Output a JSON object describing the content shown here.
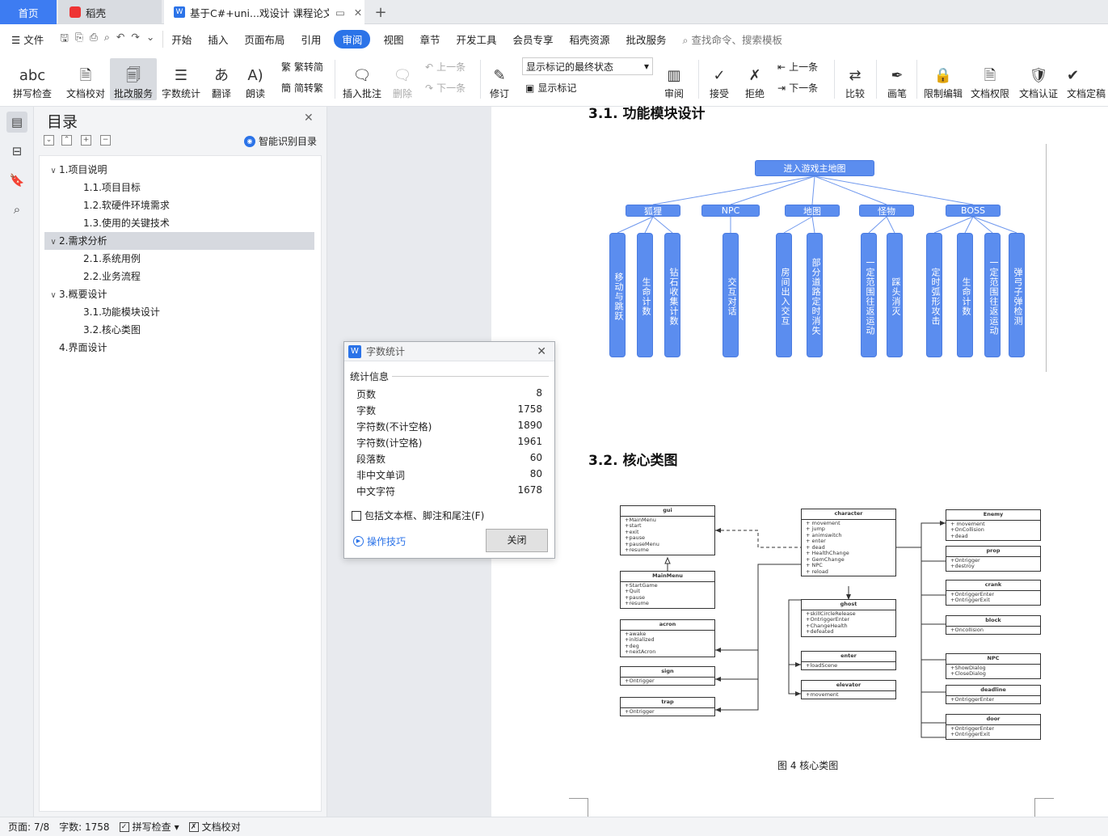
{
  "tabs": {
    "home": "首页",
    "daoke": "稻壳",
    "doc": "基于C#+uni...戏设计 课程论文",
    "add": "+"
  },
  "menu": {
    "file": "文件",
    "items": [
      "开始",
      "插入",
      "页面布局",
      "引用",
      "审阅",
      "视图",
      "章节",
      "开发工具",
      "会员专享",
      "稻壳资源",
      "批改服务"
    ],
    "active_index": 4,
    "search": "查找命令、搜索模板"
  },
  "ribbon": {
    "spell": "拼写检查",
    "proof": "文档校对",
    "review_service": "批改服务",
    "word_count": "字数统计",
    "translate": "翻译",
    "read_aloud": "朗读",
    "to_trad": "繁转简",
    "to_simp": "简转繁",
    "insert_comment": "插入批注",
    "delete": "删除",
    "prev": "上一条",
    "next": "下一条",
    "revise": "修订",
    "markup_select": "显示标记的最终状态",
    "show_markup": "显示标记",
    "review_pane": "审阅",
    "accept": "接受",
    "reject": "拒绝",
    "prev2": "上一条",
    "next2": "下一条",
    "compare": "比较",
    "pen": "画笔",
    "restrict": "限制编辑",
    "doc_rights": "文档权限",
    "doc_cert": "文档认证",
    "doc_final": "文档定稿"
  },
  "toc": {
    "title": "目录",
    "smart": "智能识别目录",
    "items": [
      {
        "label": "1.项目说明",
        "level": 1,
        "caret": "∨"
      },
      {
        "label": "1.1.项目目标",
        "level": 2
      },
      {
        "label": "1.2.软硬件环境需求",
        "level": 2
      },
      {
        "label": "1.3.使用的关键技术",
        "level": 2
      },
      {
        "label": "2.需求分析",
        "level": 1,
        "caret": "∨",
        "selected": true
      },
      {
        "label": "2.1.系统用例",
        "level": 2
      },
      {
        "label": "2.2.业务流程",
        "level": 2
      },
      {
        "label": "3.概要设计",
        "level": 1,
        "caret": "∨"
      },
      {
        "label": "3.1.功能模块设计",
        "level": 2
      },
      {
        "label": "3.2.核心类图",
        "level": 2
      },
      {
        "label": "4.界面设计",
        "level": 1
      }
    ]
  },
  "doc": {
    "h_31": "3.1. 功能模块设计",
    "h_32": "3.2. 核心类图",
    "mindmap": {
      "root": "进入游戏主地图",
      "branches": [
        {
          "name": "狐狸",
          "leaves": [
            "移动与跳跃",
            "生命计数",
            "钻石收集计数"
          ]
        },
        {
          "name": "NPC",
          "leaves": [
            "交互对话"
          ]
        },
        {
          "name": "地图",
          "leaves": [
            "房间出入交互",
            "部分道路定时消失"
          ]
        },
        {
          "name": "怪物",
          "leaves": [
            "一定范围往返运动",
            "踩头消灭"
          ]
        },
        {
          "name": "BOSS",
          "leaves": [
            "定时弧形攻击",
            "生命计数",
            "一定范围往返运动",
            "弹弓子弹检测"
          ]
        }
      ]
    },
    "uml": {
      "gui": {
        "title": "gui",
        "members": [
          "+MainMenu",
          "+start",
          "+exit",
          "+pause",
          "+pauseMenu",
          "+resume"
        ]
      },
      "mainmenu": {
        "title": "MainMenu",
        "members": [
          "+StartGame",
          "+Quit",
          "+pause",
          "+resume"
        ]
      },
      "acron": {
        "title": "acron",
        "members": [
          "+awake",
          "+initialized",
          "+deg",
          "+nextAcron"
        ]
      },
      "sign": {
        "title": "sign",
        "members": [
          "+Ontrigger"
        ]
      },
      "trap": {
        "title": "trap",
        "members": [
          "+Ontrigger"
        ]
      },
      "character": {
        "title": "character",
        "members": [
          "+ movement",
          "+ jump",
          "+ animswitch",
          "+ enter",
          "+ dead",
          "+ HealthChange",
          "+ GemChange",
          "+ NPC",
          "+ reload"
        ]
      },
      "ghost": {
        "title": "ghost",
        "members": [
          "+skillCircleRelease",
          "+OntriggerEnter",
          "+ChangeHealth",
          "+defeated"
        ]
      },
      "enter": {
        "title": "enter",
        "members": [
          "+loadScene"
        ]
      },
      "elevator": {
        "title": "elevator",
        "members": [
          "+movement"
        ]
      },
      "enemy": {
        "title": "Enemy",
        "members": [
          "+ movement",
          "+OnCollision",
          "+dead"
        ]
      },
      "prop": {
        "title": "prop",
        "members": [
          "+Ontrigger",
          "+destroy"
        ]
      },
      "crank": {
        "title": "crank",
        "members": [
          "+OntriggerEnter",
          "+OntriggerExit"
        ]
      },
      "block": {
        "title": "block",
        "members": [
          "+Oncollision"
        ]
      },
      "npc": {
        "title": "NPC",
        "members": [
          "+ShowDialog",
          "+CloseDialog"
        ]
      },
      "deadline": {
        "title": "deadline",
        "members": [
          "+OntriggerEnter"
        ]
      },
      "door": {
        "title": "door",
        "members": [
          "+OntriggerEnter",
          "+OntriggerExit"
        ]
      }
    },
    "caption": "图 4 核心类图"
  },
  "word_count": {
    "title": "字数统计",
    "section": "统计信息",
    "rows": [
      {
        "label": "页数",
        "value": "8"
      },
      {
        "label": "字数",
        "value": "1758"
      },
      {
        "label": "字符数(不计空格)",
        "value": "1890"
      },
      {
        "label": "字符数(计空格)",
        "value": "1961"
      },
      {
        "label": "段落数",
        "value": "60"
      },
      {
        "label": "非中文单词",
        "value": "80"
      },
      {
        "label": "中文字符",
        "value": "1678"
      }
    ],
    "include_label": "包括文本框、脚注和尾注(F)",
    "tips": "操作技巧",
    "close": "关闭"
  },
  "status": {
    "page": "页面: 7/8",
    "words": "字数: 1758",
    "spell": "拼写检查",
    "proof": "文档校对"
  }
}
